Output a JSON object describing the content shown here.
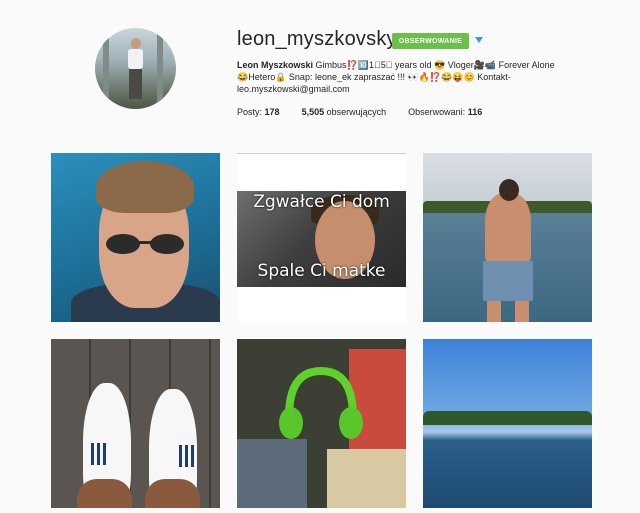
{
  "profile": {
    "username": "leon_myszkovsky",
    "follow_label": "OBSERWOWANIE",
    "full_name": "Leon Myszkowski",
    "bio_line1": "Gimbus⁉️🔟1⃣5⃣ years old 😎 Vloger🎥📹 Forever Alone",
    "bio_line2": "😂Hetero🔒 Snap: leone_ek zapraszać !!! 👀🔥⁉️😂😝😊 Kontakt-",
    "bio_line3": "leo.myszkowski@gmail.com"
  },
  "stats": {
    "posts_label": "Posty:",
    "posts_value": "178",
    "followers_value": "5,505",
    "followers_label": "obserwujących",
    "following_label": "Obserwowani:",
    "following_value": "116"
  },
  "posts": [
    {
      "id": "post-1"
    },
    {
      "id": "post-2",
      "meme_top": "Zgwałce Ci dom",
      "meme_bottom": "Spale Ci matke"
    },
    {
      "id": "post-3"
    },
    {
      "id": "post-4"
    },
    {
      "id": "post-5"
    },
    {
      "id": "post-6"
    }
  ],
  "colors": {
    "follow_button": "#6cc04a",
    "dropdown_arrow": "#3897f0"
  },
  "icons": {
    "dropdown": "triangle-down-icon"
  }
}
